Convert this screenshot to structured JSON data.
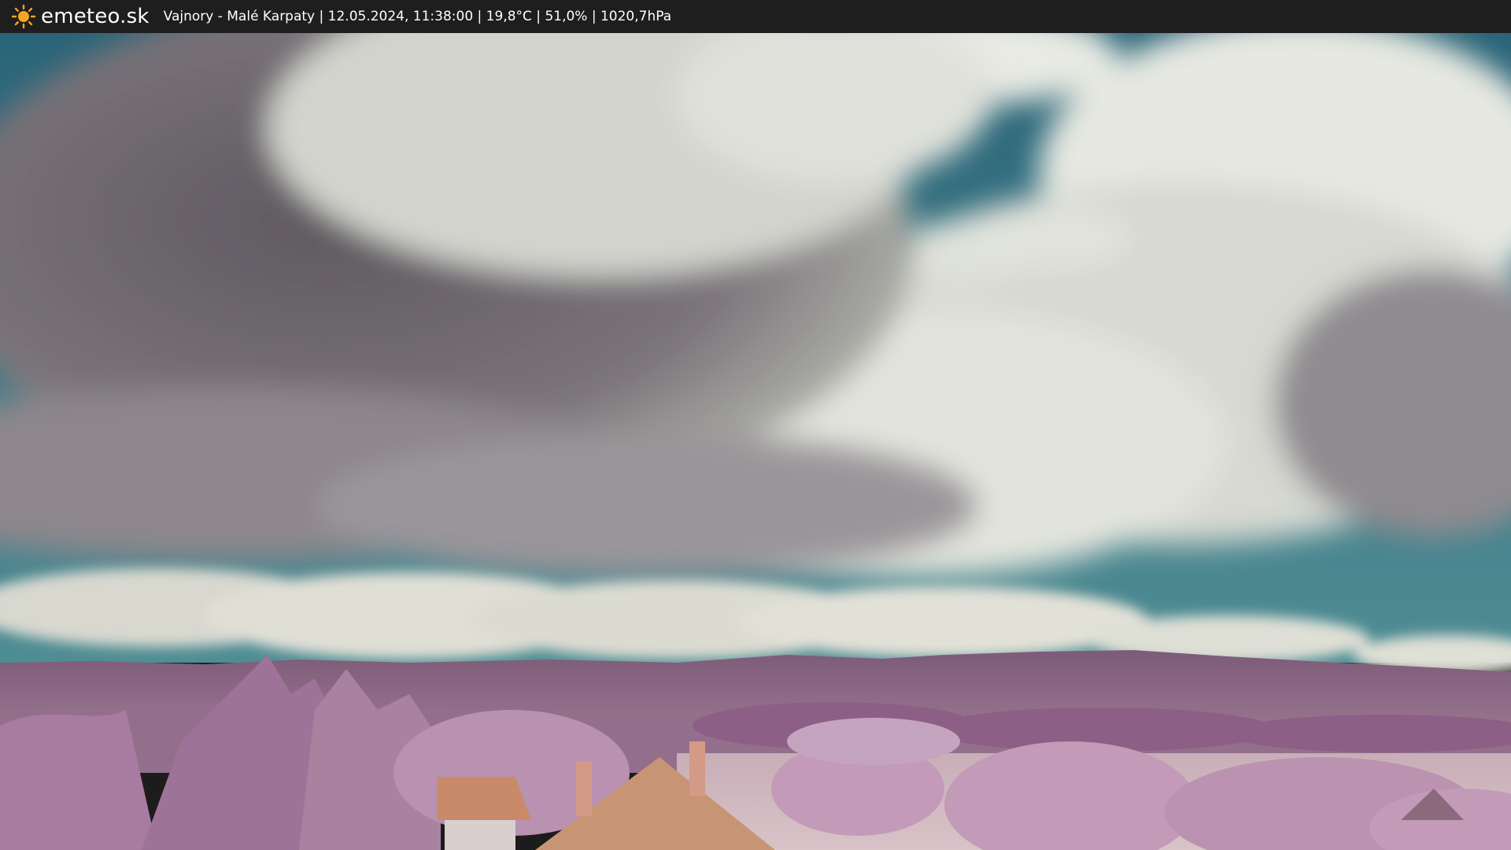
{
  "header": {
    "brand": "emeteo.sk",
    "caption": "Vajnory - Malé Karpaty | 12.05.2024, 11:38:00 | 19,8°C | 51,0% | 1020,7hPa",
    "logo_icon": "sun-icon"
  },
  "colors": {
    "bar_background": "#1e1e1e",
    "sun": "#f5a623",
    "sky": "#2f6f80",
    "cloud_dark": "#6e6870",
    "cloud_light": "#e4e6df",
    "hills": "#8a6a86",
    "foliage": "#b58fb0",
    "roof": "#c98a6a"
  }
}
